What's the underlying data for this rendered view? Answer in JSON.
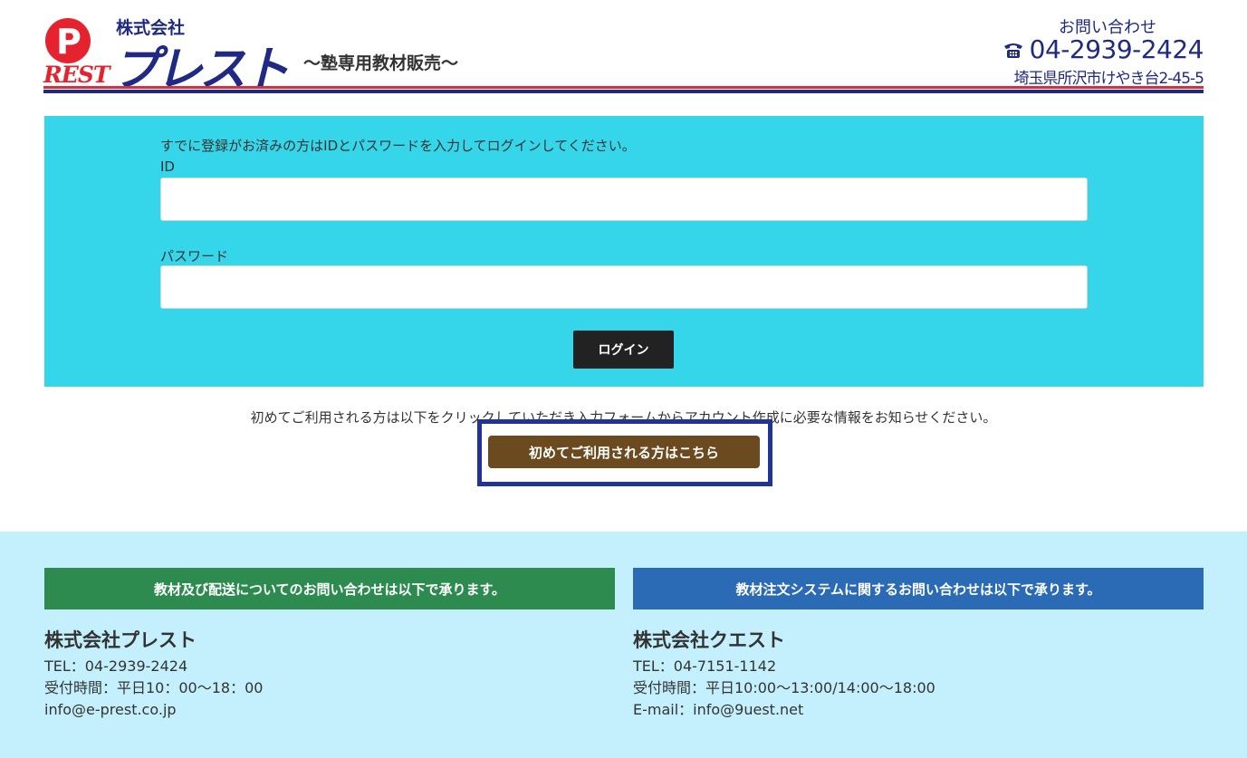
{
  "header": {
    "logo_letter": "P",
    "logo_rest": "REST",
    "company_label": "株式会社",
    "company_name": "プレスト",
    "tagline": "〜塾専用教材販売〜",
    "contact_heading": "お問い合わせ",
    "phone_icon": "telephone-icon",
    "phone": "04-2939-2424",
    "address": "埼玉県所沢市けやき台2-45-5",
    "colors": {
      "brand_blue": "#1f2a85",
      "brand_red": "#e5232f"
    }
  },
  "login": {
    "intro": "すでに登録がお済みの方はIDとパスワードを入力してログインしてください。",
    "id_label": "ID",
    "id_value": "",
    "password_label": "パスワード",
    "password_value": "",
    "button_label": "ログイン",
    "panel_color": "#36d6ea"
  },
  "register": {
    "note": "初めてご利用される方は以下をクリックしていただき入力フォームからアカウント作成に必要な情報をお知らせください。",
    "button_label": "初めてご利用される方はこちら",
    "button_color": "#6b4a1f",
    "highlight_color": "#1f3494"
  },
  "footer": {
    "left": {
      "banner": "教材及び配送についてのお問い合わせは以下で承ります。",
      "company": "株式会社プレスト",
      "tel": "TEL：04-2939-2424",
      "hours": "受付時間：平日10：00〜18：00",
      "email": "info@e-prest.co.jp",
      "banner_color": "#2e8b50"
    },
    "right": {
      "banner": "教材注文システムに関するお問い合わせは以下で承ります。",
      "company": "株式会社クエスト",
      "tel": "TEL：04-7151-1142",
      "hours": "受付時間：平日10:00〜13:00/14:00〜18:00",
      "email": "E-mail：info@9uest.net",
      "banner_color": "#2b6ab5"
    },
    "background": "#c3f0fc"
  }
}
